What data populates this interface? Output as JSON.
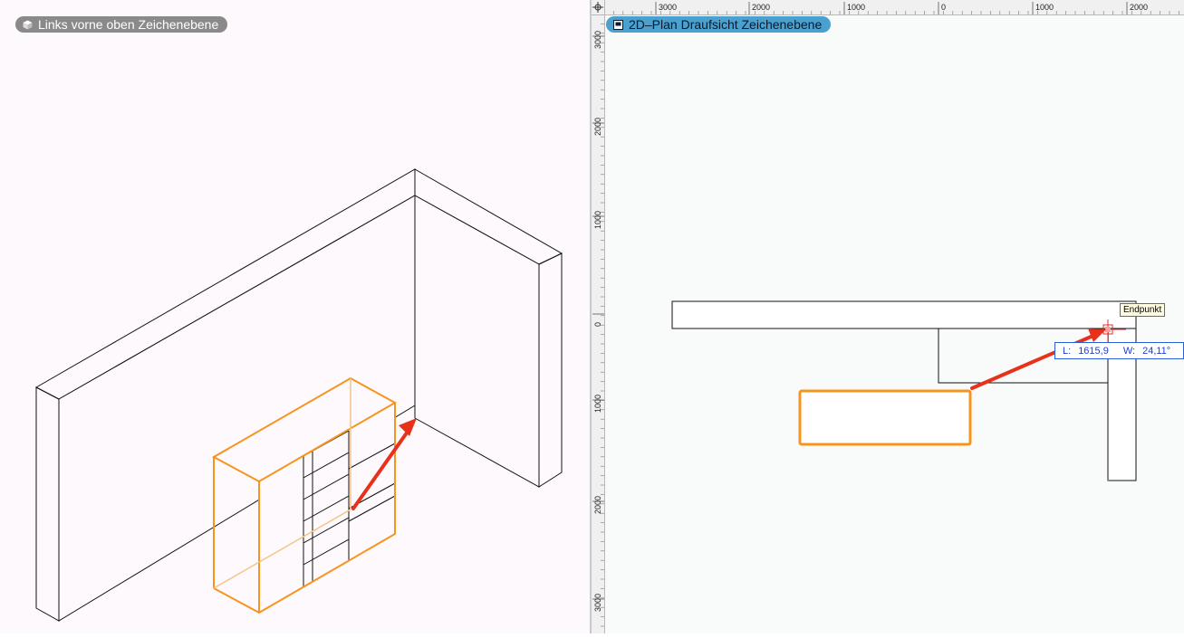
{
  "left_view": {
    "badge_label": "Links vorne oben  Zeichenebene",
    "icon": "cube-icon"
  },
  "right_view": {
    "badge_label": "2D–Plan Draufsicht  Zeichenebene",
    "icon": "plan-view-icon"
  },
  "ruler_top": {
    "labels": [
      "3000",
      "2000",
      "1000",
      "0",
      "1000",
      "2000"
    ]
  },
  "ruler_left": {
    "labels": [
      "3000",
      "2000",
      "1000",
      "0",
      "1000",
      "2000",
      "3000"
    ]
  },
  "snap_tooltip": "Endpunkt",
  "measurement": {
    "length_label": "L:",
    "length_value": "1615,9",
    "angle_label": "W:",
    "angle_value": "24,11°"
  },
  "colors": {
    "selection": "#f7941d",
    "arrow": "#e8311a",
    "snap": "#e03030",
    "measure_text": "#1b3fd0"
  }
}
